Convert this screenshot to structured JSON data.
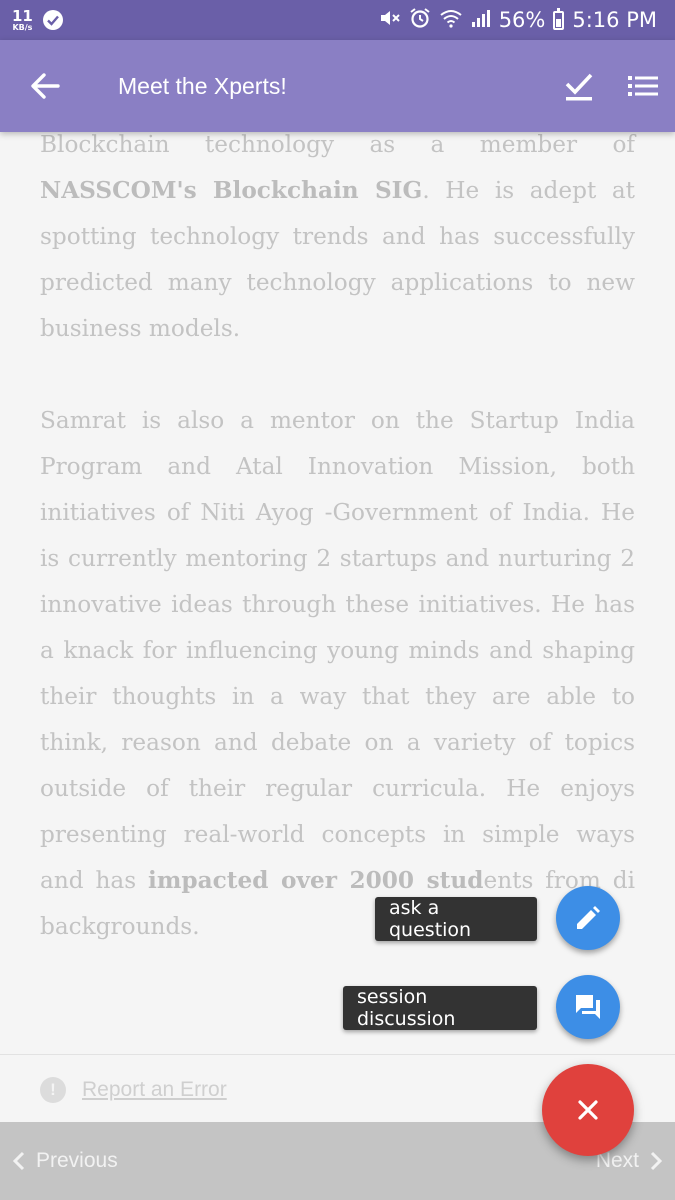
{
  "status_bar": {
    "net_speed": "11",
    "net_unit": "KB/s",
    "battery": "56%",
    "time": "5:16 PM"
  },
  "app_bar": {
    "title": "Meet the Xperts!"
  },
  "content": {
    "p1_line1": "Blockchain technology as a member of",
    "p1_bold": "NASSCOM's Blockchain SIG",
    "p1_rest": ". He is adept at spotting technology trends and has successfully predicted many technology applications to new business models.",
    "p2_text": "Samrat is also a mentor on the Startup India Program and Atal Innovation Mission, both initiatives of Niti Ayog -Government of India. He is currently mentoring 2 startups and nurturing 2 innovative ideas through these initiatives. He has a knack for influencing young minds and shaping their thoughts in a way that they are able to think, reason and debate on a variety of topics outside of their regular curricula. He enjoys presenting real-world concepts in simple ways and has",
    "p2_bold": "impacted over 2000 stud",
    "p2_tail_hidden": "ents from di",
    "p2_end": "backgrounds."
  },
  "report": {
    "label": "Report an Error"
  },
  "bottom_nav": {
    "previous": "Previous",
    "next": "Next"
  },
  "fab_menu": {
    "ask_label": "ask a question",
    "discussion_label": "session discussion"
  },
  "colors": {
    "status_bar": "#6a5fa8",
    "app_bar": "#8a7fc4",
    "mini_fab": "#3d8ee6",
    "main_fab": "#e0413d",
    "bottom_nav": "#c4c4c4"
  }
}
